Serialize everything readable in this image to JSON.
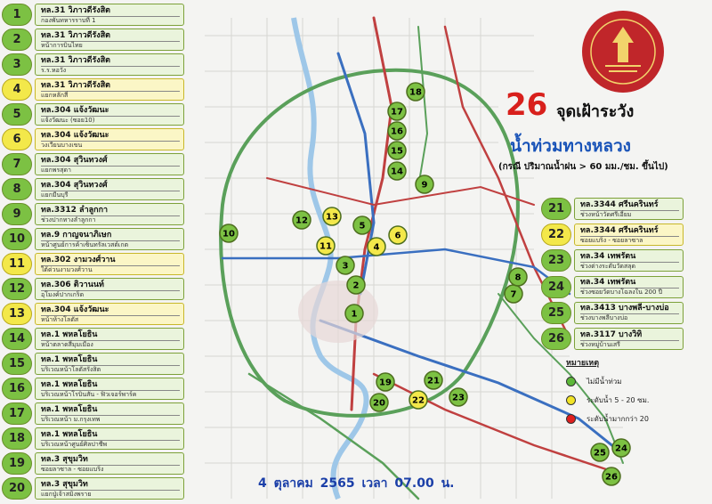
{
  "header": {
    "count": "26",
    "title": "จุดเฝ้าระวัง",
    "subtitle": "น้ำท่วมทางหลวง",
    "condition": "(กรณี ปริมาณน้ำฝน > 60 มม./ชม. ขึ้นไป)",
    "logo_text": "กรมทางหลวง",
    "logo_caption": "DEPARTMENT OF HIGHWAYS"
  },
  "date_text": "4  ตุลาคม 2565  เวลา  07.00 น.",
  "legend": {
    "title": "หมายเหตุ",
    "items": [
      {
        "color": "#5cb838",
        "label": "ไม่มีน้ำท่วม"
      },
      {
        "color": "#f1e326",
        "label": "ระดับน้ำ  5 - 20  ซม."
      },
      {
        "color": "#e01e1e",
        "label": "ระดับน้ำมากกว่า  20"
      }
    ]
  },
  "colors": {
    "green": "#7cc143",
    "yellow": "#f3e84a",
    "title_red": "#d8201c",
    "title_blue": "#1a54b8"
  },
  "points_left": [
    {
      "n": "1",
      "road": "ทล.31 วิภาวดีรังสิต",
      "loc": "กองพันทหารราบที่ 1",
      "status": "green"
    },
    {
      "n": "2",
      "road": "ทล.31 วิภาวดีรังสิต",
      "loc": "หน้าการบินไทย",
      "status": "green"
    },
    {
      "n": "3",
      "road": "ทล.31 วิภาวดีรังสิต",
      "loc": "ร.ร.หอวัง",
      "status": "green"
    },
    {
      "n": "4",
      "road": "ทล.31 วิภาวดีรังสิต",
      "loc": "แยกหลักสี่",
      "status": "yellow"
    },
    {
      "n": "5",
      "road": "ทล.304 แจ้งวัฒนะ",
      "loc": "แจ้งวัฒนะ (ซอย10)",
      "status": "green"
    },
    {
      "n": "6",
      "road": "ทล.304 แจ้งวัฒนะ",
      "loc": "วงเวียนบางเขน",
      "status": "yellow"
    },
    {
      "n": "7",
      "road": "ทล.304 สุวินทวงศ์",
      "loc": "แยกพรสุดา",
      "status": "green"
    },
    {
      "n": "8",
      "road": "ทล.304 สุวินทวงศ์",
      "loc": "แยกมีนบุรี",
      "status": "green"
    },
    {
      "n": "9",
      "road": "ทล.3312 ลำลูกกา",
      "loc": "ช่วงปากทางลำลูกกา",
      "status": "green"
    },
    {
      "n": "10",
      "road": "ทล.9 กาญจนาภิเษก",
      "loc": "หน้าศูนย์การค้าเซ็นทรัลเวสต์เกต",
      "status": "green"
    },
    {
      "n": "11",
      "road": "ทล.302  งามวงศ์วาน",
      "loc": "ใต้ด่วนงามวงศ์วาน",
      "status": "yellow"
    },
    {
      "n": "12",
      "road": "ทล.306 ติวานนท์",
      "loc": "อุโมงค์ปากเกร็ด",
      "status": "green"
    },
    {
      "n": "13",
      "road": "ทล.304 แจ้งวัฒนะ",
      "loc": "หน้าห้างโลตัส",
      "status": "yellow"
    },
    {
      "n": "14",
      "road": "ทล.1  พหลโยธิน",
      "loc": "หน้าตลาดสี่มุมเมือง",
      "status": "green"
    },
    {
      "n": "15",
      "road": "ทล.1  พหลโยธิน",
      "loc": "บริเวณหน้าโลตัสรังสิต",
      "status": "green"
    },
    {
      "n": "16",
      "road": "ทล.1  พหลโยธิน",
      "loc": "บริเวณหน้าโรบินสัน - ฟิวเจอร์พาร์ค",
      "status": "green"
    },
    {
      "n": "17",
      "road": "ทล.1  พหลโยธิน",
      "loc": "บริเวณหน้า ม.กรุงเทพ",
      "status": "green"
    },
    {
      "n": "18",
      "road": "ทล.1  พหลโยธิน",
      "loc": "บริเวณหน้าศูนย์ศิลปาชีพ",
      "status": "green"
    },
    {
      "n": "19",
      "road": "ทล.3  สุขุมวิท",
      "loc": "ซอยลาซาล - ซอยแบริ่ง",
      "status": "green"
    },
    {
      "n": "20",
      "road": "ทล.3  สุขุมวิท",
      "loc": "แยกปู่เจ้าสมิงพราย",
      "status": "green"
    }
  ],
  "points_right": [
    {
      "n": "21",
      "road": "ทล.3344 ศรีนครินทร์",
      "loc": "ช่วงหน้าวัดศรีเอี่ยม",
      "status": "green"
    },
    {
      "n": "22",
      "road": "ทล.3344 ศรีนครินทร์",
      "loc": "ซอยแบริ่ง - ซอยลาซาล",
      "status": "yellow"
    },
    {
      "n": "23",
      "road": "ทล.34  เทพรัตน",
      "loc": "ช่วงต่างระดับวัดสลุด",
      "status": "green"
    },
    {
      "n": "24",
      "road": "ทล.34  เทพรัตน",
      "loc": "ช่วงซอยวัดบางโฉลงใน 200 ปี",
      "status": "green"
    },
    {
      "n": "25",
      "road": "ทล.3413  บางพลี-บางบ่อ",
      "loc": "ช่วงบางพลีบางบ่อ",
      "status": "green"
    },
    {
      "n": "26",
      "road": "ทล.3117  บางวิทิ",
      "loc": "ช่วงหมู่บ้านเสรี",
      "status": "green"
    }
  ],
  "markers": [
    {
      "n": "1",
      "status": "green"
    },
    {
      "n": "2",
      "status": "green"
    },
    {
      "n": "3",
      "status": "green"
    },
    {
      "n": "4",
      "status": "yellow"
    },
    {
      "n": "5",
      "status": "green"
    },
    {
      "n": "6",
      "status": "yellow"
    },
    {
      "n": "7",
      "status": "green"
    },
    {
      "n": "8",
      "status": "green"
    },
    {
      "n": "9",
      "status": "green"
    },
    {
      "n": "10",
      "status": "green"
    },
    {
      "n": "11",
      "status": "yellow"
    },
    {
      "n": "12",
      "status": "green"
    },
    {
      "n": "13",
      "status": "yellow"
    },
    {
      "n": "14",
      "status": "green"
    },
    {
      "n": "15",
      "status": "green"
    },
    {
      "n": "16",
      "status": "green"
    },
    {
      "n": "17",
      "status": "green"
    },
    {
      "n": "18",
      "status": "green"
    },
    {
      "n": "19",
      "status": "green"
    },
    {
      "n": "20",
      "status": "green"
    },
    {
      "n": "21",
      "status": "green"
    },
    {
      "n": "22",
      "status": "yellow"
    },
    {
      "n": "23",
      "status": "green"
    },
    {
      "n": "24",
      "status": "green"
    },
    {
      "n": "25",
      "status": "green"
    },
    {
      "n": "26",
      "status": "green"
    }
  ]
}
